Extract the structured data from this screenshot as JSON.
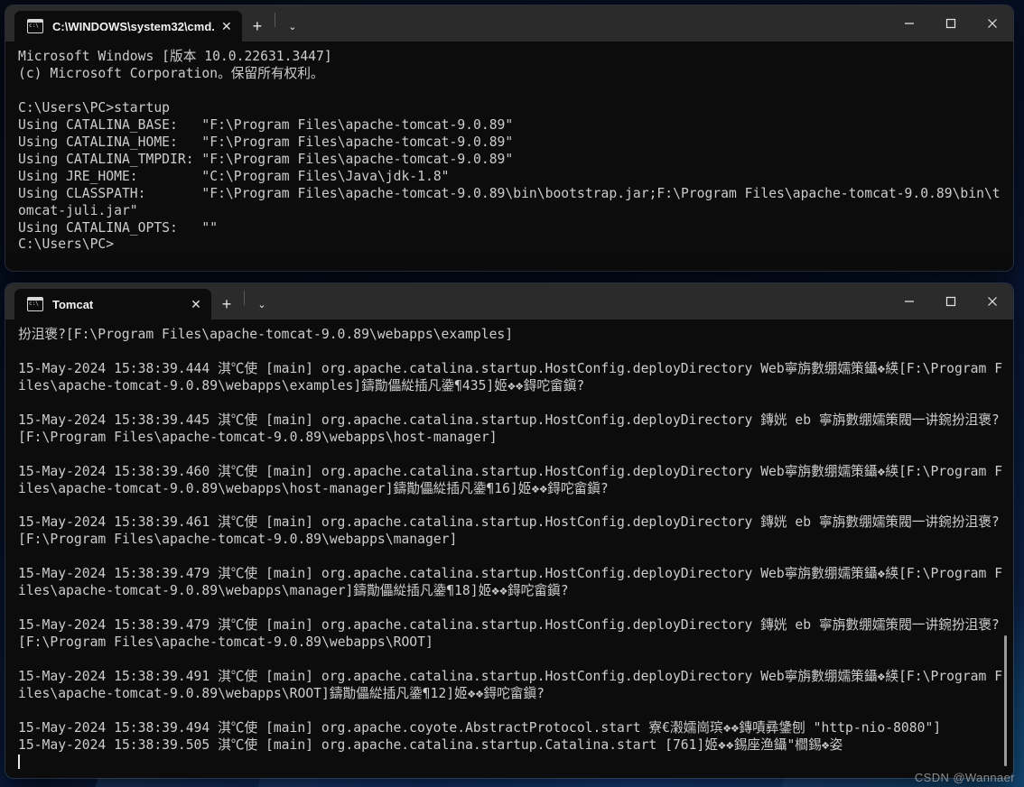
{
  "desktop": {
    "wallpaper_colors": [
      "#050a16",
      "#123061",
      "#1f78ad"
    ]
  },
  "windows": [
    {
      "id": "cmd",
      "tab": {
        "title": "C:\\WINDOWS\\system32\\cmd.",
        "icon": "console-icon",
        "close_label": "✕"
      },
      "toolbar": {
        "new_tab_label": "+",
        "dropdown_label": "⌄"
      },
      "caption": {
        "minimize_label": "─",
        "maximize_label": "□",
        "close_label": "✕"
      },
      "lines": [
        "Microsoft Windows [版本 10.0.22631.3447]",
        "(c) Microsoft Corporation。保留所有权利。",
        "",
        "C:\\Users\\PC>startup",
        "Using CATALINA_BASE:   \"F:\\Program Files\\apache-tomcat-9.0.89\"",
        "Using CATALINA_HOME:   \"F:\\Program Files\\apache-tomcat-9.0.89\"",
        "Using CATALINA_TMPDIR: \"F:\\Program Files\\apache-tomcat-9.0.89\"",
        "Using JRE_HOME:        \"C:\\Program Files\\Java\\jdk-1.8\"",
        "Using CLASSPATH:       \"F:\\Program Files\\apache-tomcat-9.0.89\\bin\\bootstrap.jar;F:\\Program Files\\apache-tomcat-9.0.89\\bin\\tomcat-juli.jar\"",
        "Using CATALINA_OPTS:   \"\"",
        "C:\\Users\\PC>"
      ]
    },
    {
      "id": "tomcat",
      "tab": {
        "title": "Tomcat",
        "icon": "console-icon",
        "close_label": "✕"
      },
      "toolbar": {
        "new_tab_label": "+",
        "dropdown_label": "⌄"
      },
      "caption": {
        "minimize_label": "─",
        "maximize_label": "□",
        "close_label": "✕"
      },
      "lines": [
        "扮沮褒?[F:\\Program Files\\apache-tomcat-9.0.89\\webapps\\examples]",
        "",
        "15-May-2024 15:38:39.444 淇℃使 [main] org.apache.catalina.startup.HostConfig.deployDirectory Web寧旃數绷嬬策鑷❖緓[F:\\Program Files\\apache-tomcat-9.0.89\\webapps\\examples]鑄勩儡緃插凡鍌¶435]姬❖❖鍀咜畲鎭?",
        "",
        "15-May-2024 15:38:39.445 淇℃使 [main] org.apache.catalina.startup.HostConfig.deployDirectory 鏄姯 eb 寧旃數绷嬬策閥一讲鋺扮沮褒?[F:\\Program Files\\apache-tomcat-9.0.89\\webapps\\host-manager]",
        "",
        "15-May-2024 15:38:39.460 淇℃使 [main] org.apache.catalina.startup.HostConfig.deployDirectory Web寧旃數绷嬬策鑷❖緓[F:\\Program Files\\apache-tomcat-9.0.89\\webapps\\host-manager]鑄勩儡緃插凡鍌¶16]姬❖❖鍀咜畲鎭?",
        "",
        "15-May-2024 15:38:39.461 淇℃使 [main] org.apache.catalina.startup.HostConfig.deployDirectory 鏄姯 eb 寧旃數绷嬬策閥一讲鋺扮沮褒?[F:\\Program Files\\apache-tomcat-9.0.89\\webapps\\manager]",
        "",
        "15-May-2024 15:38:39.479 淇℃使 [main] org.apache.catalina.startup.HostConfig.deployDirectory Web寧旃數绷嬬策鑷❖緓[F:\\Program Files\\apache-tomcat-9.0.89\\webapps\\manager]鑄勩儡緃插凡鍌¶18]姬❖❖鍀咜畲鎭?",
        "",
        "15-May-2024 15:38:39.479 淇℃使 [main] org.apache.catalina.startup.HostConfig.deployDirectory 鏄姯 eb 寧旃數绷嬬策閥一讲鋺扮沮褒?[F:\\Program Files\\apache-tomcat-9.0.89\\webapps\\ROOT]",
        "",
        "15-May-2024 15:38:39.491 淇℃使 [main] org.apache.catalina.startup.HostConfig.deployDirectory Web寧旃數绷嬬策鑷❖緓[F:\\Program Files\\apache-tomcat-9.0.89\\webapps\\ROOT]鑄勩儡緃插凡鍌¶12]姬❖❖鍀咜畲鎭?",
        "",
        "15-May-2024 15:38:39.494 淇℃使 [main] org.apache.coyote.AbstractProtocol.start 寮€濲嬬崗瑸❖❖鏄嘖彞鎥刨 \"http-nio-8080\"]",
        "15-May-2024 15:38:39.505 淇℃使 [main] org.apache.catalina.startup.Catalina.start [761]姬❖❖錫座渔鑷\"櫩錫❖姿"
      ]
    }
  ],
  "watermark": {
    "text": "CSDN @Wannaer"
  }
}
